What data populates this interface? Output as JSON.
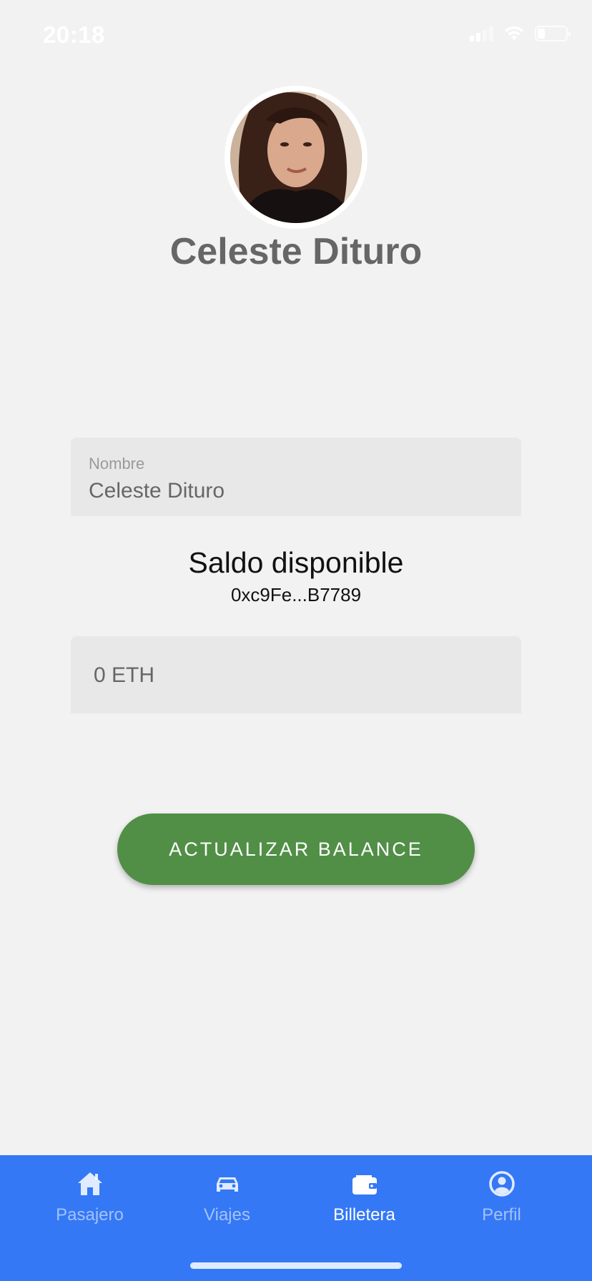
{
  "status_bar": {
    "time": "20:18"
  },
  "profile": {
    "name": "Celeste Dituro"
  },
  "name_field": {
    "label": "Nombre",
    "value": "Celeste Dituro"
  },
  "wallet": {
    "title": "Saldo disponible",
    "address": "0xc9Fe...B7789",
    "balance": "0 ETH"
  },
  "actions": {
    "update_label": "ACTUALIZAR BALANCE"
  },
  "tabs": [
    {
      "label": "Pasajero",
      "icon": "home-icon",
      "active": false
    },
    {
      "label": "Viajes",
      "icon": "car-icon",
      "active": false
    },
    {
      "label": "Billetera",
      "icon": "wallet-icon",
      "active": true
    },
    {
      "label": "Perfil",
      "icon": "user-circle-icon",
      "active": false
    }
  ],
  "colors": {
    "tab_bar": "#3478f6",
    "primary_button": "#518f47"
  }
}
